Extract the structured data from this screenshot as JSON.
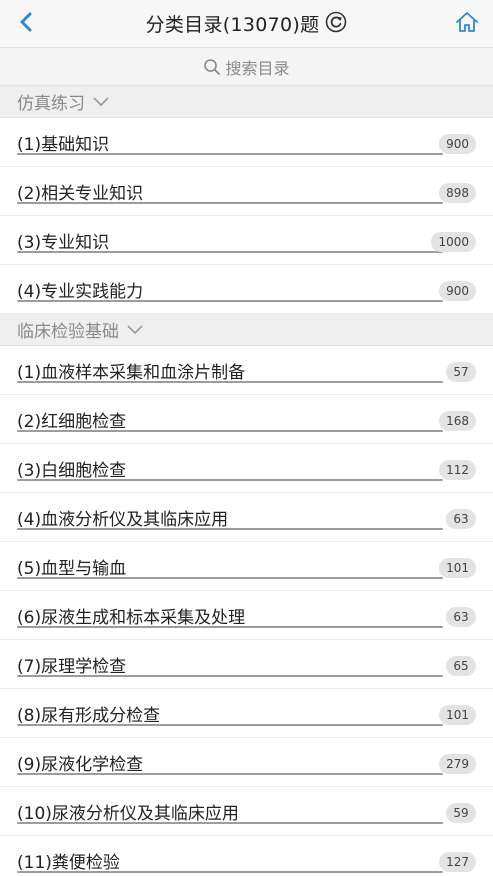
{
  "header": {
    "title": "分类目录(13070)题",
    "back_icon": "chevron-left-icon",
    "refresh_icon": "refresh-icon",
    "home_icon": "home-icon",
    "accent": "#2f86d6"
  },
  "search": {
    "placeholder": "搜索目录",
    "icon": "search-icon"
  },
  "sections": [
    {
      "title": "仿真练习",
      "items": [
        {
          "label": "(1)基础知识",
          "count": "900"
        },
        {
          "label": "(2)相关专业知识",
          "count": "898"
        },
        {
          "label": "(3)专业知识",
          "count": "1000"
        },
        {
          "label": "(4)专业实践能力",
          "count": "900"
        }
      ]
    },
    {
      "title": "临床检验基础",
      "items": [
        {
          "label": "(1)血液样本采集和血涂片制备",
          "count": "57"
        },
        {
          "label": "(2)红细胞检查",
          "count": "168"
        },
        {
          "label": "(3)白细胞检查",
          "count": "112"
        },
        {
          "label": "(4)血液分析仪及其临床应用",
          "count": "63"
        },
        {
          "label": "(5)血型与输血",
          "count": "101"
        },
        {
          "label": "(6)尿液生成和标本采集及处理",
          "count": "63"
        },
        {
          "label": "(7)尿理学检查",
          "count": "65"
        },
        {
          "label": "(8)尿有形成分检查",
          "count": "101"
        },
        {
          "label": "(9)尿液化学检查",
          "count": "279"
        },
        {
          "label": "(10)尿液分析仪及其临床应用",
          "count": "59"
        },
        {
          "label": "(11)粪便检验",
          "count": "127"
        }
      ]
    }
  ]
}
